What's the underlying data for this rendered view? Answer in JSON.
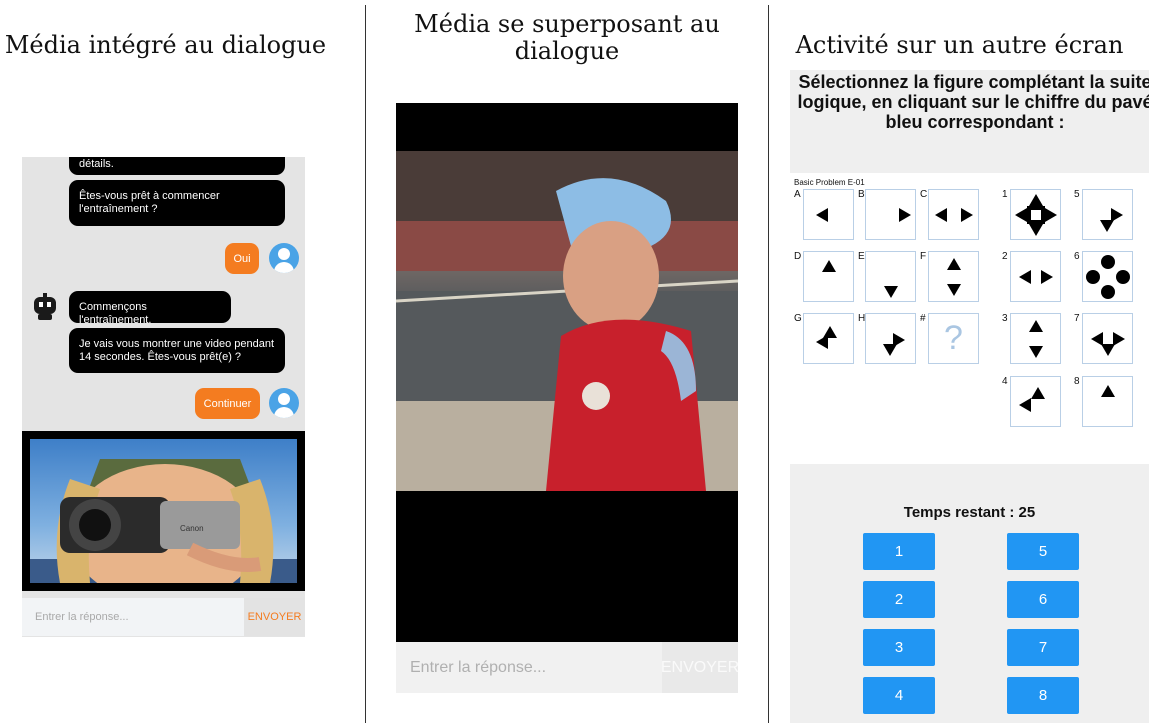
{
  "columns": {
    "col1_title": "Média intégré au dialogue",
    "col2_title_line1": "Média se superposant au",
    "col2_title_line2": "dialogue",
    "col3_title": "Activité sur un autre écran"
  },
  "panel1": {
    "messages": [
      {
        "from": "bot",
        "text": "détails."
      },
      {
        "from": "bot",
        "text": "Êtes-vous prêt à commencer l'entraînement ?"
      },
      {
        "from": "user",
        "text": "Oui"
      },
      {
        "from": "bot",
        "text": "Commençons l'entraînement."
      },
      {
        "from": "bot",
        "text": "Je vais vous montrer une video pendant 14 secondes. Êtes-vous prêt(e) ?"
      },
      {
        "from": "user",
        "text": "Continuer"
      }
    ],
    "input_placeholder": "Entrer la réponse...",
    "send_label": "ENVOYER",
    "video_caption": "Canon"
  },
  "panel2": {
    "input_placeholder": "Entrer la réponse...",
    "send_label": "ENVOYER"
  },
  "panel3": {
    "instruction": "Sélectionnez la figure complétant la suite logique, en cliquant sur le chiffre du pavé bleu correspondant :",
    "problem_label": "Basic Problem E-01",
    "letters": [
      "A",
      "B",
      "C",
      "D",
      "E",
      "F",
      "G",
      "H",
      "#"
    ],
    "numbers": [
      "1",
      "2",
      "3",
      "4",
      "5",
      "6",
      "7",
      "8"
    ],
    "missing_mark": "?",
    "timer_text": "Temps restant : 25",
    "buttons": [
      "1",
      "5",
      "2",
      "6",
      "3",
      "7",
      "4",
      "8"
    ]
  },
  "colors": {
    "orange": "#f47c20",
    "blue_button": "#2196f3",
    "avatar_blue": "#4aa3e6",
    "panel_grey": "#e4e4e4"
  }
}
